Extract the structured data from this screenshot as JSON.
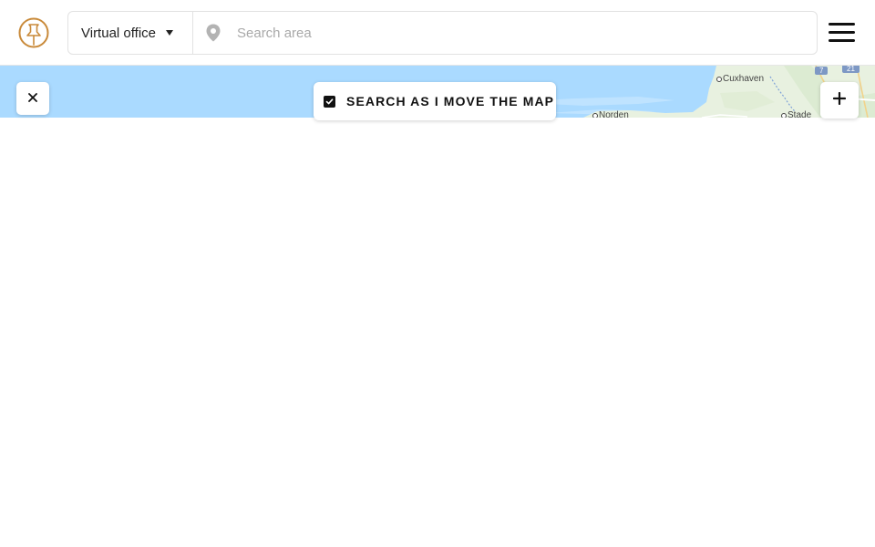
{
  "header": {
    "logo_icon": "pushpin-logo-icon",
    "brand_color": "#c98a3a",
    "type_select": {
      "value": "Virtual office"
    },
    "area_search": {
      "placeholder": "Search area",
      "value": ""
    },
    "menu_icon": "hamburger-menu-icon"
  },
  "map": {
    "water_color": "#aadaff",
    "land_color": "#e8f1e0",
    "towns": [
      {
        "name": "Cuxhaven"
      },
      {
        "name": "Norden"
      },
      {
        "name": "Stade"
      }
    ],
    "road_badges": [
      "7",
      "21"
    ]
  },
  "controls": {
    "close_icon": "close-icon",
    "search_as_move": {
      "label": "SEARCH AS I MOVE THE MAP",
      "checked": true
    },
    "zoom_in_icon": "plus-icon"
  }
}
